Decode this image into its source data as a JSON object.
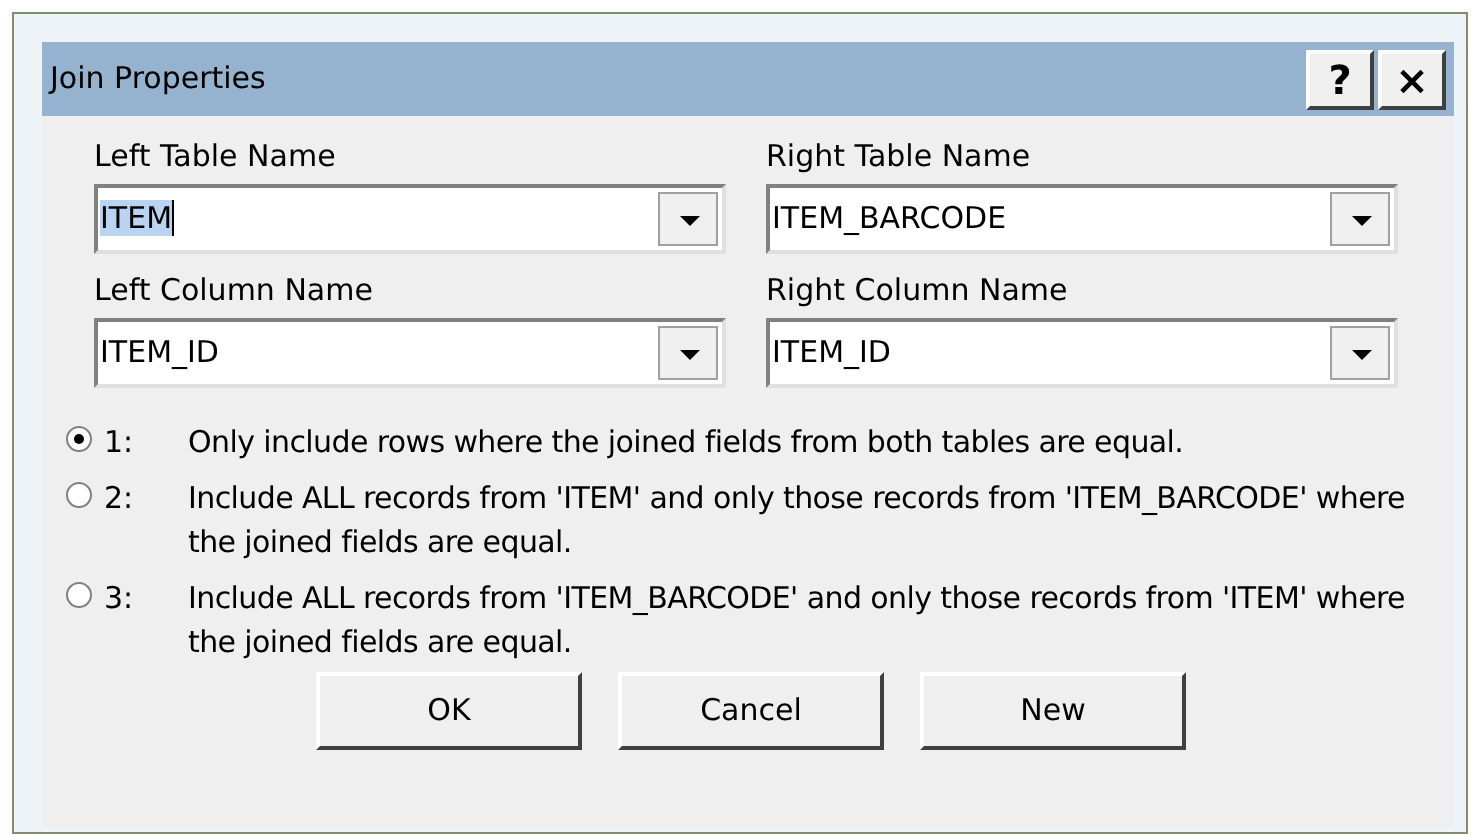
{
  "window": {
    "title": "Join Properties",
    "title_buttons": [
      "?",
      "×"
    ]
  },
  "fields": [
    {
      "label": "Left Table Name",
      "value": "ITEM",
      "text_selected": true
    },
    {
      "label": "Right Table Name",
      "value": "ITEM_BARCODE",
      "text_selected": false
    },
    {
      "label": "Left Column Name",
      "value": "ITEM_ID",
      "text_selected": false
    },
    {
      "label": "Right Column Name",
      "value": "ITEM_ID",
      "text_selected": false
    }
  ],
  "options": [
    {
      "number": "1:",
      "text": "Only include rows where the joined fields from both tables are equal.",
      "selected": true
    },
    {
      "number": "2:",
      "text": "Include ALL records from 'ITEM' and only those records from 'ITEM_BARCODE' where the joined fields are equal.",
      "selected": false
    },
    {
      "number": "3:",
      "text": "Include ALL records from 'ITEM_BARCODE' and only those records from 'ITEM' where the joined fields are equal.",
      "selected": false
    }
  ],
  "buttons": [
    "OK",
    "Cancel",
    "New"
  ]
}
